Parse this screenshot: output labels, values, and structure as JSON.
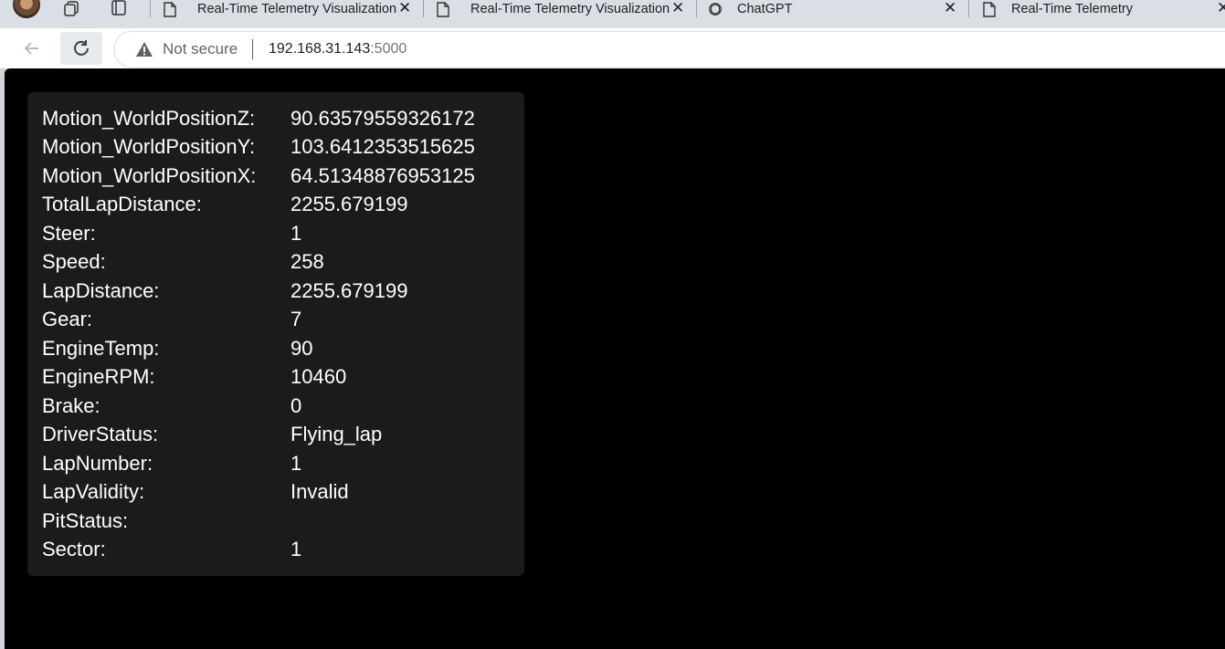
{
  "browser": {
    "tabs": [
      {
        "title": "Real-Time Telemetry Visualization",
        "icon": "page-icon"
      },
      {
        "title": "Real-Time Telemetry Visualization",
        "icon": "page-icon"
      },
      {
        "title": "ChatGPT",
        "icon": "chatgpt-icon"
      },
      {
        "title": "Real-Time Telemetry",
        "icon": "page-icon"
      }
    ],
    "security_label": "Not secure",
    "url_host": "192.168.31.143",
    "url_port": ":5000"
  },
  "telemetry": {
    "rows": [
      {
        "key": "Motion_WorldPositionZ:",
        "value": "90.63579559326172"
      },
      {
        "key": "Motion_WorldPositionY:",
        "value": "103.6412353515625"
      },
      {
        "key": "Motion_WorldPositionX:",
        "value": "64.51348876953125"
      },
      {
        "key": "TotalLapDistance:",
        "value": "2255.679199"
      },
      {
        "key": "Steer:",
        "value": "1"
      },
      {
        "key": "Speed:",
        "value": "258"
      },
      {
        "key": "LapDistance:",
        "value": "2255.679199"
      },
      {
        "key": "Gear:",
        "value": "7"
      },
      {
        "key": "EngineTemp:",
        "value": "90"
      },
      {
        "key": "EngineRPM:",
        "value": "10460"
      },
      {
        "key": "Brake:",
        "value": "0"
      },
      {
        "key": "DriverStatus:",
        "value": "Flying_lap"
      },
      {
        "key": "LapNumber:",
        "value": "1"
      },
      {
        "key": "LapValidity:",
        "value": "Invalid"
      },
      {
        "key": "PitStatus:",
        "value": ""
      },
      {
        "key": "Sector:",
        "value": "1"
      }
    ]
  }
}
